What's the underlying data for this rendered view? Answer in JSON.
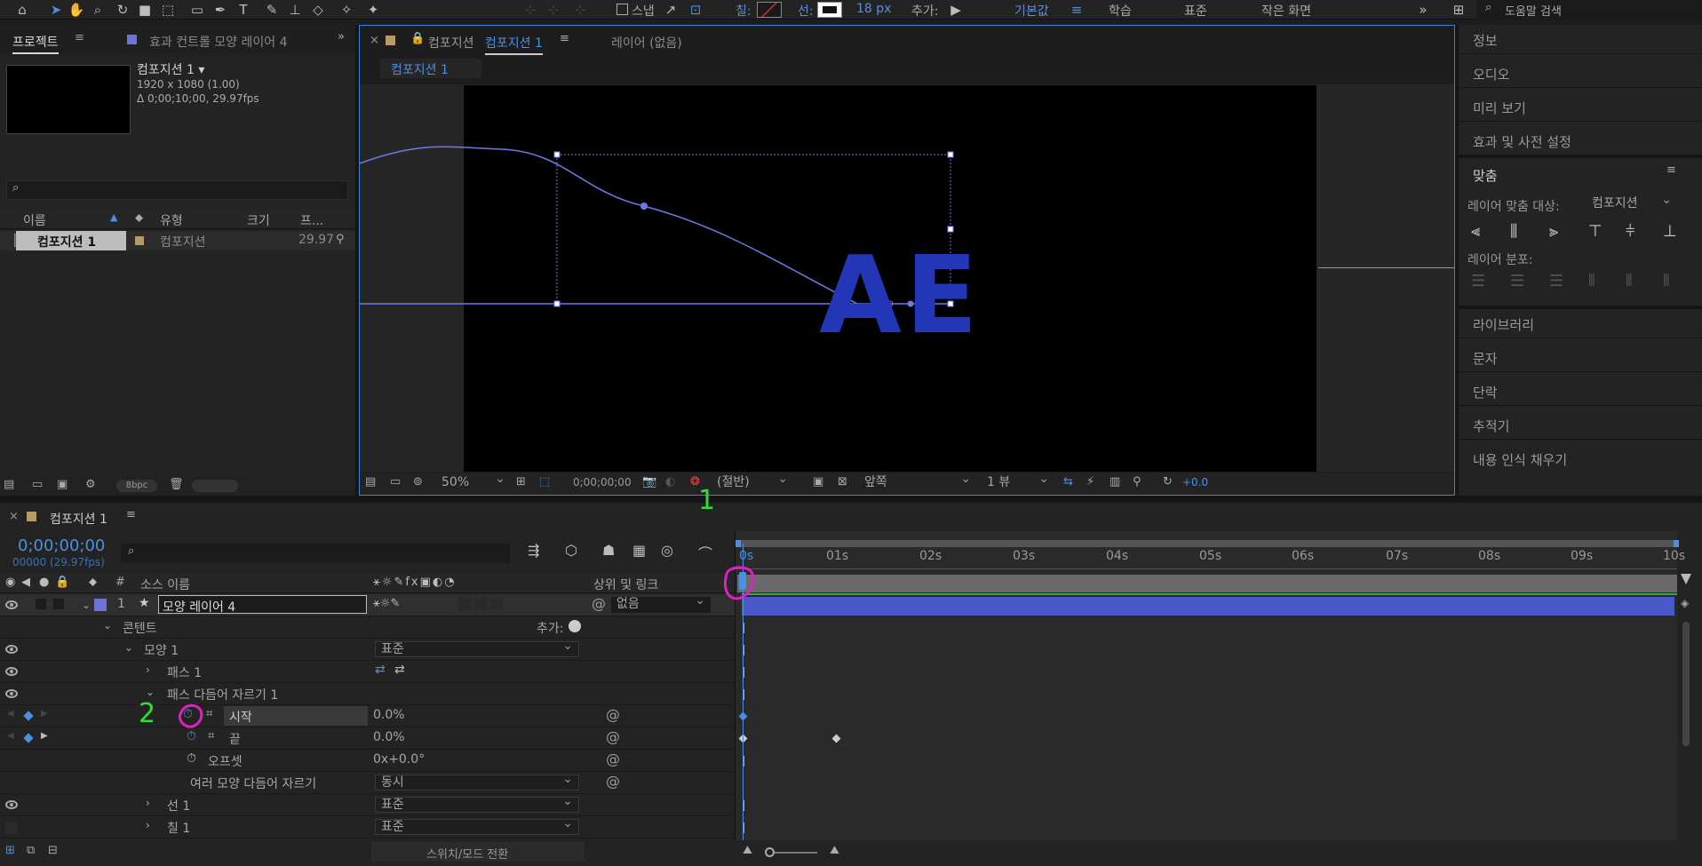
{
  "toolbar": {
    "snap_label": "스냅",
    "fill_label": "칠:",
    "stroke_label": "선:",
    "stroke_width": "18 px",
    "add_label": "추가:",
    "workspaces": [
      "기본값",
      "학습",
      "표준",
      "작은 화면"
    ],
    "help_search_placeholder": "도움말 검색"
  },
  "project": {
    "tab_label": "프로젝트",
    "effects_tab_label": "효과 컨트롤 모양 레이어 4",
    "comp_name": "컴포지션 1 ▾",
    "comp_res": "1920 x 1080 (1.00)",
    "comp_duration": "Δ 0;00;10;00, 29.97fps",
    "columns": [
      "이름",
      "유형",
      "크기",
      "프..."
    ],
    "items": [
      {
        "name": "컴포지션 1",
        "type": "컴포지션",
        "fps": "29.97"
      }
    ],
    "bpc": "8bpc"
  },
  "viewer": {
    "tab_label": "컴포지션",
    "tab_comp": "컴포지션 1",
    "layer_tab": "레이어 (없음)",
    "breadcrumb": "컴포지션 1",
    "canvas_text": "AE",
    "zoom": "50%",
    "timecode": "0;00;00;00",
    "resolution": "(절반)",
    "view_side": "앞쪽",
    "views": "1 뷰",
    "exposure": "+0.0"
  },
  "right_panel": {
    "items_top": [
      "정보",
      "오디오",
      "미리 보기",
      "효과 및 사전 설정"
    ],
    "align_title": "맞춤",
    "align_to_label": "레이어 맞춤 대상:",
    "align_to_value": "컴포지션",
    "distribute_label": "레이어 분포:",
    "items_bottom": [
      "라이브러리",
      "문자",
      "단락",
      "추적기",
      "내용 인식 채우기"
    ]
  },
  "annotations": {
    "mark1": "1",
    "mark2": "2"
  },
  "timeline": {
    "tab_label": "컴포지션 1",
    "timecode": "0;00;00;00",
    "frame_info": "00000 (29.97fps)",
    "col_source": "소스 이름",
    "col_parent": "상위 및 링크",
    "layer_num": "1",
    "layer_name": "모양 레이어 4",
    "parent_value": "없음",
    "content_label": "콘텐트",
    "add_label": "추가:",
    "shape1": "모양 1",
    "shape1_mode": "표준",
    "path1": "패스 1",
    "trim": "패스 다듬어 자르기 1",
    "start_label": "시작",
    "start_value": "0.0%",
    "end_label": "끝",
    "end_value": "0.0%",
    "offset_label": "오프셋",
    "offset_value": "0x+0.0°",
    "multi_trim_label": "여러 모양 다듬어 자르기",
    "multi_trim_value": "동시",
    "stroke1": "선 1",
    "stroke1_mode": "표준",
    "fill1": "칠 1",
    "fill1_mode": "표준",
    "toggle_label": "스위치/모드 전환",
    "ruler": [
      "0s",
      "01s",
      "02s",
      "03s",
      "04s",
      "05s",
      "06s",
      "07s",
      "08s",
      "09s",
      "10s"
    ]
  }
}
